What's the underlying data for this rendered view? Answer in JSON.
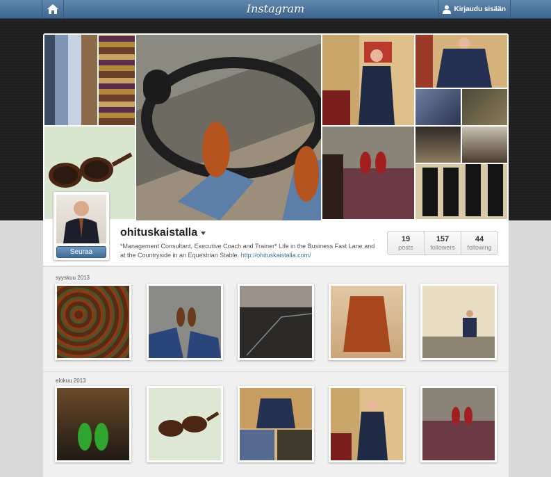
{
  "header": {
    "logo": "Instagram",
    "home_icon": "home-icon",
    "login_label": "Kirjaudu sisään",
    "login_icon": "user-icon",
    "colors": {
      "bar": "#4a739b",
      "accent": "#3f729b"
    }
  },
  "profile": {
    "username": "ohituskaistalla",
    "follow_label": "Seuraa",
    "bio": "*Management Consultant, Executive Coach and Trainer* Life in the Business Fast Lane and at the Countryside in an Equestrian Stable.",
    "link": "http://ohituskaistalla.com/",
    "stats": [
      {
        "value": "19",
        "label": "posts"
      },
      {
        "value": "157",
        "label": "followers"
      },
      {
        "value": "44",
        "label": "following"
      }
    ]
  },
  "sections": [
    {
      "month": "syyskuu 2013"
    },
    {
      "month": "elokuu 2013"
    }
  ]
}
